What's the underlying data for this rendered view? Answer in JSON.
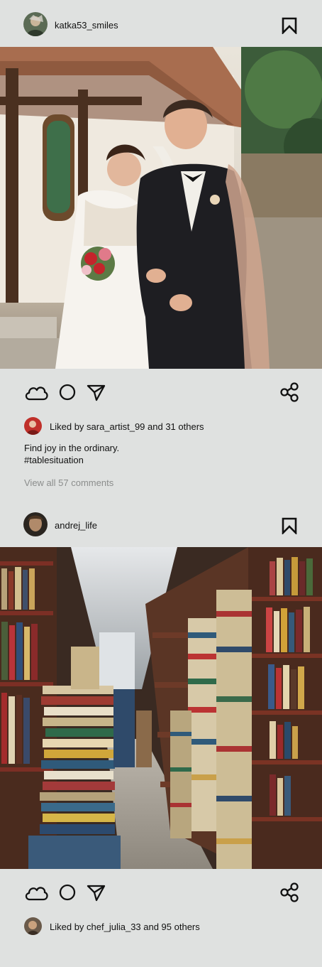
{
  "posts": [
    {
      "username": "katka53_smiles",
      "likes_text": "Liked by sara_artist_99 and 31 others",
      "caption_line1": "Find joy in the ordinary.",
      "caption_line2": "#tablesituation",
      "comments_link": "View all 57 comments"
    },
    {
      "username": "andrej_life",
      "likes_text": "Liked by chef_julia_33 and 95 others"
    }
  ],
  "icons": {
    "like": "cloud-icon",
    "comment": "circle-icon",
    "send": "paper-plane-icon",
    "share": "share-icon",
    "save": "bookmark-icon"
  },
  "colors": {
    "background": "#dfe1e0",
    "text": "#111111",
    "muted": "#8b8d8c"
  }
}
